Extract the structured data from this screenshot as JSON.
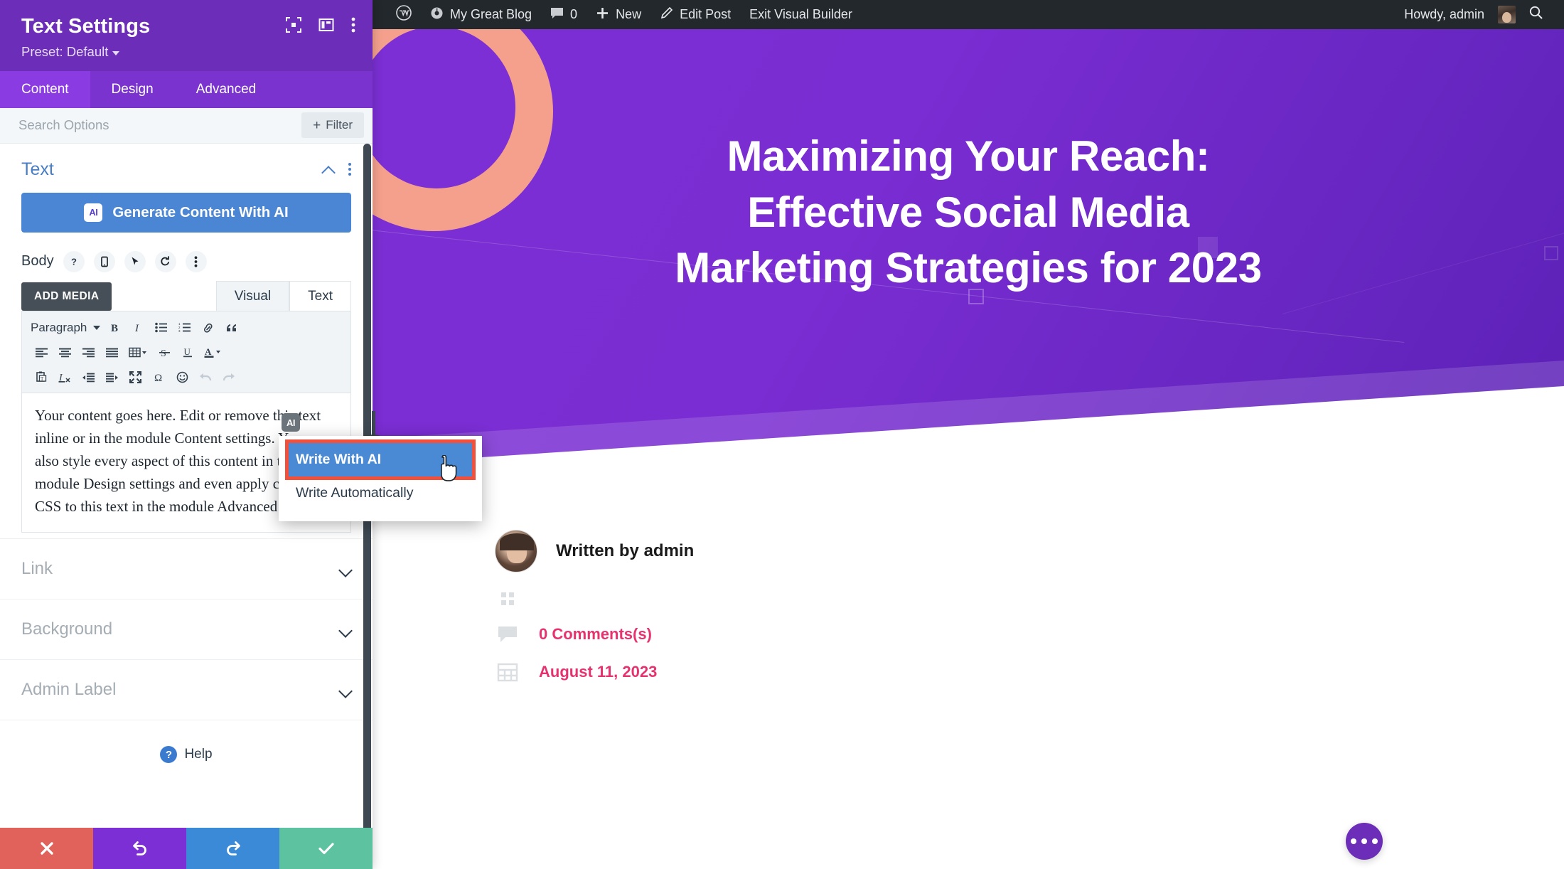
{
  "sidebar": {
    "title": "Text Settings",
    "preset_label": "Preset: Default",
    "header_icons": [
      "focus-frame-icon",
      "panel-layout-icon",
      "vertical-dots-icon"
    ],
    "tabs": [
      {
        "label": "Content",
        "active": true
      },
      {
        "label": "Design",
        "active": false
      },
      {
        "label": "Advanced",
        "active": false
      }
    ],
    "search": {
      "placeholder": "Search Options",
      "value": ""
    },
    "filter_button": {
      "label": "Filter",
      "plus": "+"
    },
    "text_section": {
      "title": "Text",
      "ai_button_label": "Generate Content With AI",
      "ai_badge_text": "AI",
      "body_label": "Body",
      "body_icons": [
        "help-icon",
        "responsive-icon",
        "hover-icon",
        "reset-icon",
        "options-dots-icon"
      ],
      "add_media_label": "ADD MEDIA",
      "editor_tabs": [
        {
          "label": "Visual",
          "active": true
        },
        {
          "label": "Text",
          "active": false
        }
      ],
      "toolbar_row1": [
        "paragraph-format-select",
        "bold",
        "italic",
        "bulleted-list",
        "numbered-list",
        "link",
        "blockquote"
      ],
      "paragraph_label": "Paragraph",
      "toolbar_row2": [
        "align-left",
        "align-center",
        "align-right",
        "align-justify",
        "table",
        "strikethrough",
        "underline",
        "text-color"
      ],
      "toolbar_row3": [
        "paste-as-text",
        "clear-formatting",
        "outdent",
        "indent",
        "fullscreen",
        "special-character",
        "emoji",
        "undo",
        "redo"
      ],
      "content": "Your content goes here. Edit or remove this text inline or in the module Content settings. You can also style every aspect of this content in the module Design settings and even apply custom CSS to this text in the module Advanced settings."
    },
    "closed_sections": [
      {
        "title": "Link"
      },
      {
        "title": "Background"
      },
      {
        "title": "Admin Label"
      }
    ],
    "help_label": "Help",
    "help_badge": "?",
    "footer_buttons": [
      {
        "name": "cancel",
        "glyph": "✕",
        "color": "#e0625b"
      },
      {
        "name": "undo",
        "glyph": "↺",
        "color": "#7B2FD4"
      },
      {
        "name": "redo",
        "glyph": "↻",
        "color": "#3a8ad8"
      },
      {
        "name": "save",
        "glyph": "✓",
        "color": "#5cc2a0"
      }
    ]
  },
  "ai_menu": {
    "badge": "AI",
    "items": [
      {
        "label": "Write With AI",
        "highlighted": true
      },
      {
        "label": "Write Automatically",
        "highlighted": false
      }
    ]
  },
  "admin_bar": {
    "wp_logo": "wordpress-logo-icon",
    "site_name": "My Great Blog",
    "comments_count": "0",
    "new_label": "New",
    "edit_post_label": "Edit Post",
    "exit_label": "Exit Visual Builder",
    "howdy": "Howdy, admin",
    "search_icon": "search-icon"
  },
  "hero": {
    "title_line1": "Maximizing Your Reach:",
    "title_line2": "Effective Social Media",
    "title_line3": "Marketing Strategies for 2023",
    "colors": {
      "bg_purple": "#7B2FD4",
      "bg_deep": "#5B21B6",
      "ring_peach": "#F4A08D",
      "teal": "#78CDD0",
      "accent_pink": "#F0739E"
    }
  },
  "post_meta": {
    "author_text": "Written by admin",
    "categories_icon": "categories-grid-icon",
    "comments_text": "0 Comments(s)",
    "comments_icon": "comment-bubble-icon",
    "date_text": "August 11, 2023",
    "date_icon": "calendar-icon",
    "link_color": "#E6336F"
  },
  "fab": {
    "name": "page-settings-button",
    "glyph": "…"
  }
}
